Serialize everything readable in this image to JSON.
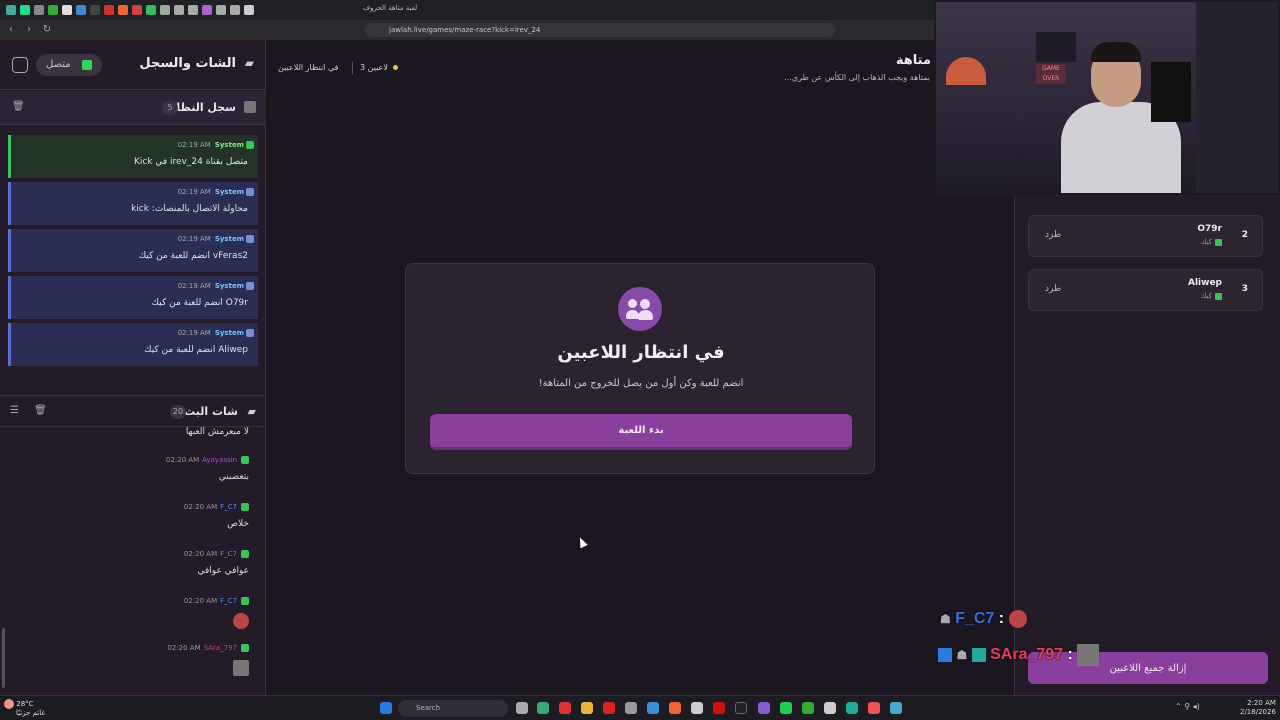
{
  "browser": {
    "tab_title": "لعبة متاهة الحروف",
    "url": "jawlah.live/games/maze-race?kick=irev_24"
  },
  "sidebar": {
    "title": "الشات والسجل",
    "connection_status": "متصل",
    "system_log": {
      "title": "سجل النظام",
      "count": "5",
      "items": [
        {
          "sender": "System",
          "time": "02:19 AM",
          "text": "متصل بقناة irev_24 في Kick",
          "kind": "success"
        },
        {
          "sender": "System",
          "time": "02:19 AM",
          "text": "محاولة الاتصال بالمنصات: kick",
          "kind": "info"
        },
        {
          "sender": "System",
          "time": "02:19 AM",
          "text": "vFeras2 انضم للعبة من كيك",
          "kind": "info"
        },
        {
          "sender": "System",
          "time": "02:19 AM",
          "text": "O79r انضم للعبة من كيك",
          "kind": "info"
        },
        {
          "sender": "System",
          "time": "02:19 AM",
          "text": "Aliwep انضم للعبة من كيك",
          "kind": "info"
        }
      ]
    },
    "stream_chat": {
      "title": "شات البث",
      "count": "20",
      "partial_text": "لا مبعرمش العبها",
      "messages": [
        {
          "user": "Ayayassin",
          "time": "02:20 AM",
          "text": "بتعصبني",
          "color": "#b04ad0"
        },
        {
          "user": "F_C7",
          "time": "02:20 AM",
          "text": "خلاص",
          "color": "#4a8bf0"
        },
        {
          "user": "F_C7",
          "time": "02:20 AM",
          "text": "عوافي عوافي",
          "color": "#4a8bf0"
        },
        {
          "user": "F_C7",
          "time": "02:20 AM",
          "text": "",
          "color": "#4a8bf0"
        },
        {
          "user": "SAra_797",
          "time": "02:20 AM",
          "text": "",
          "color": "#e0405a"
        }
      ]
    }
  },
  "main": {
    "title": "متاهة",
    "subtitle": "بمتاهة ويجب الذهاب إلى الكأس عن طري...",
    "players_count": "3 لاعبين",
    "status": "في انتظار اللاعبين",
    "card": {
      "title": "في انتظار اللاعبين",
      "subtitle": "انضم للعبة وكن أول من يصل للخروج من المتاهة!",
      "start_button": "بدء اللعبة"
    }
  },
  "players_panel": {
    "players": [
      {
        "rank": "2",
        "name": "O79r",
        "platform": "كيك",
        "kick_label": "طرد"
      },
      {
        "rank": "3",
        "name": "Aliwep",
        "platform": "كيك",
        "kick_label": "طرد"
      }
    ],
    "remove_all_button": "إزالة جميع اللاعبين"
  },
  "overlay_chat": [
    {
      "user": "F_C7",
      "sep": ":"
    },
    {
      "user": "SAra_797",
      "sep": ":"
    }
  ],
  "webcam": {
    "sign_text": "GAME OVER"
  },
  "taskbar": {
    "weather_temp": "28°C",
    "weather_desc": "غائم جزئيًا",
    "search_placeholder": "Search",
    "time": "2:20 AM",
    "date": "2/18/2026"
  }
}
